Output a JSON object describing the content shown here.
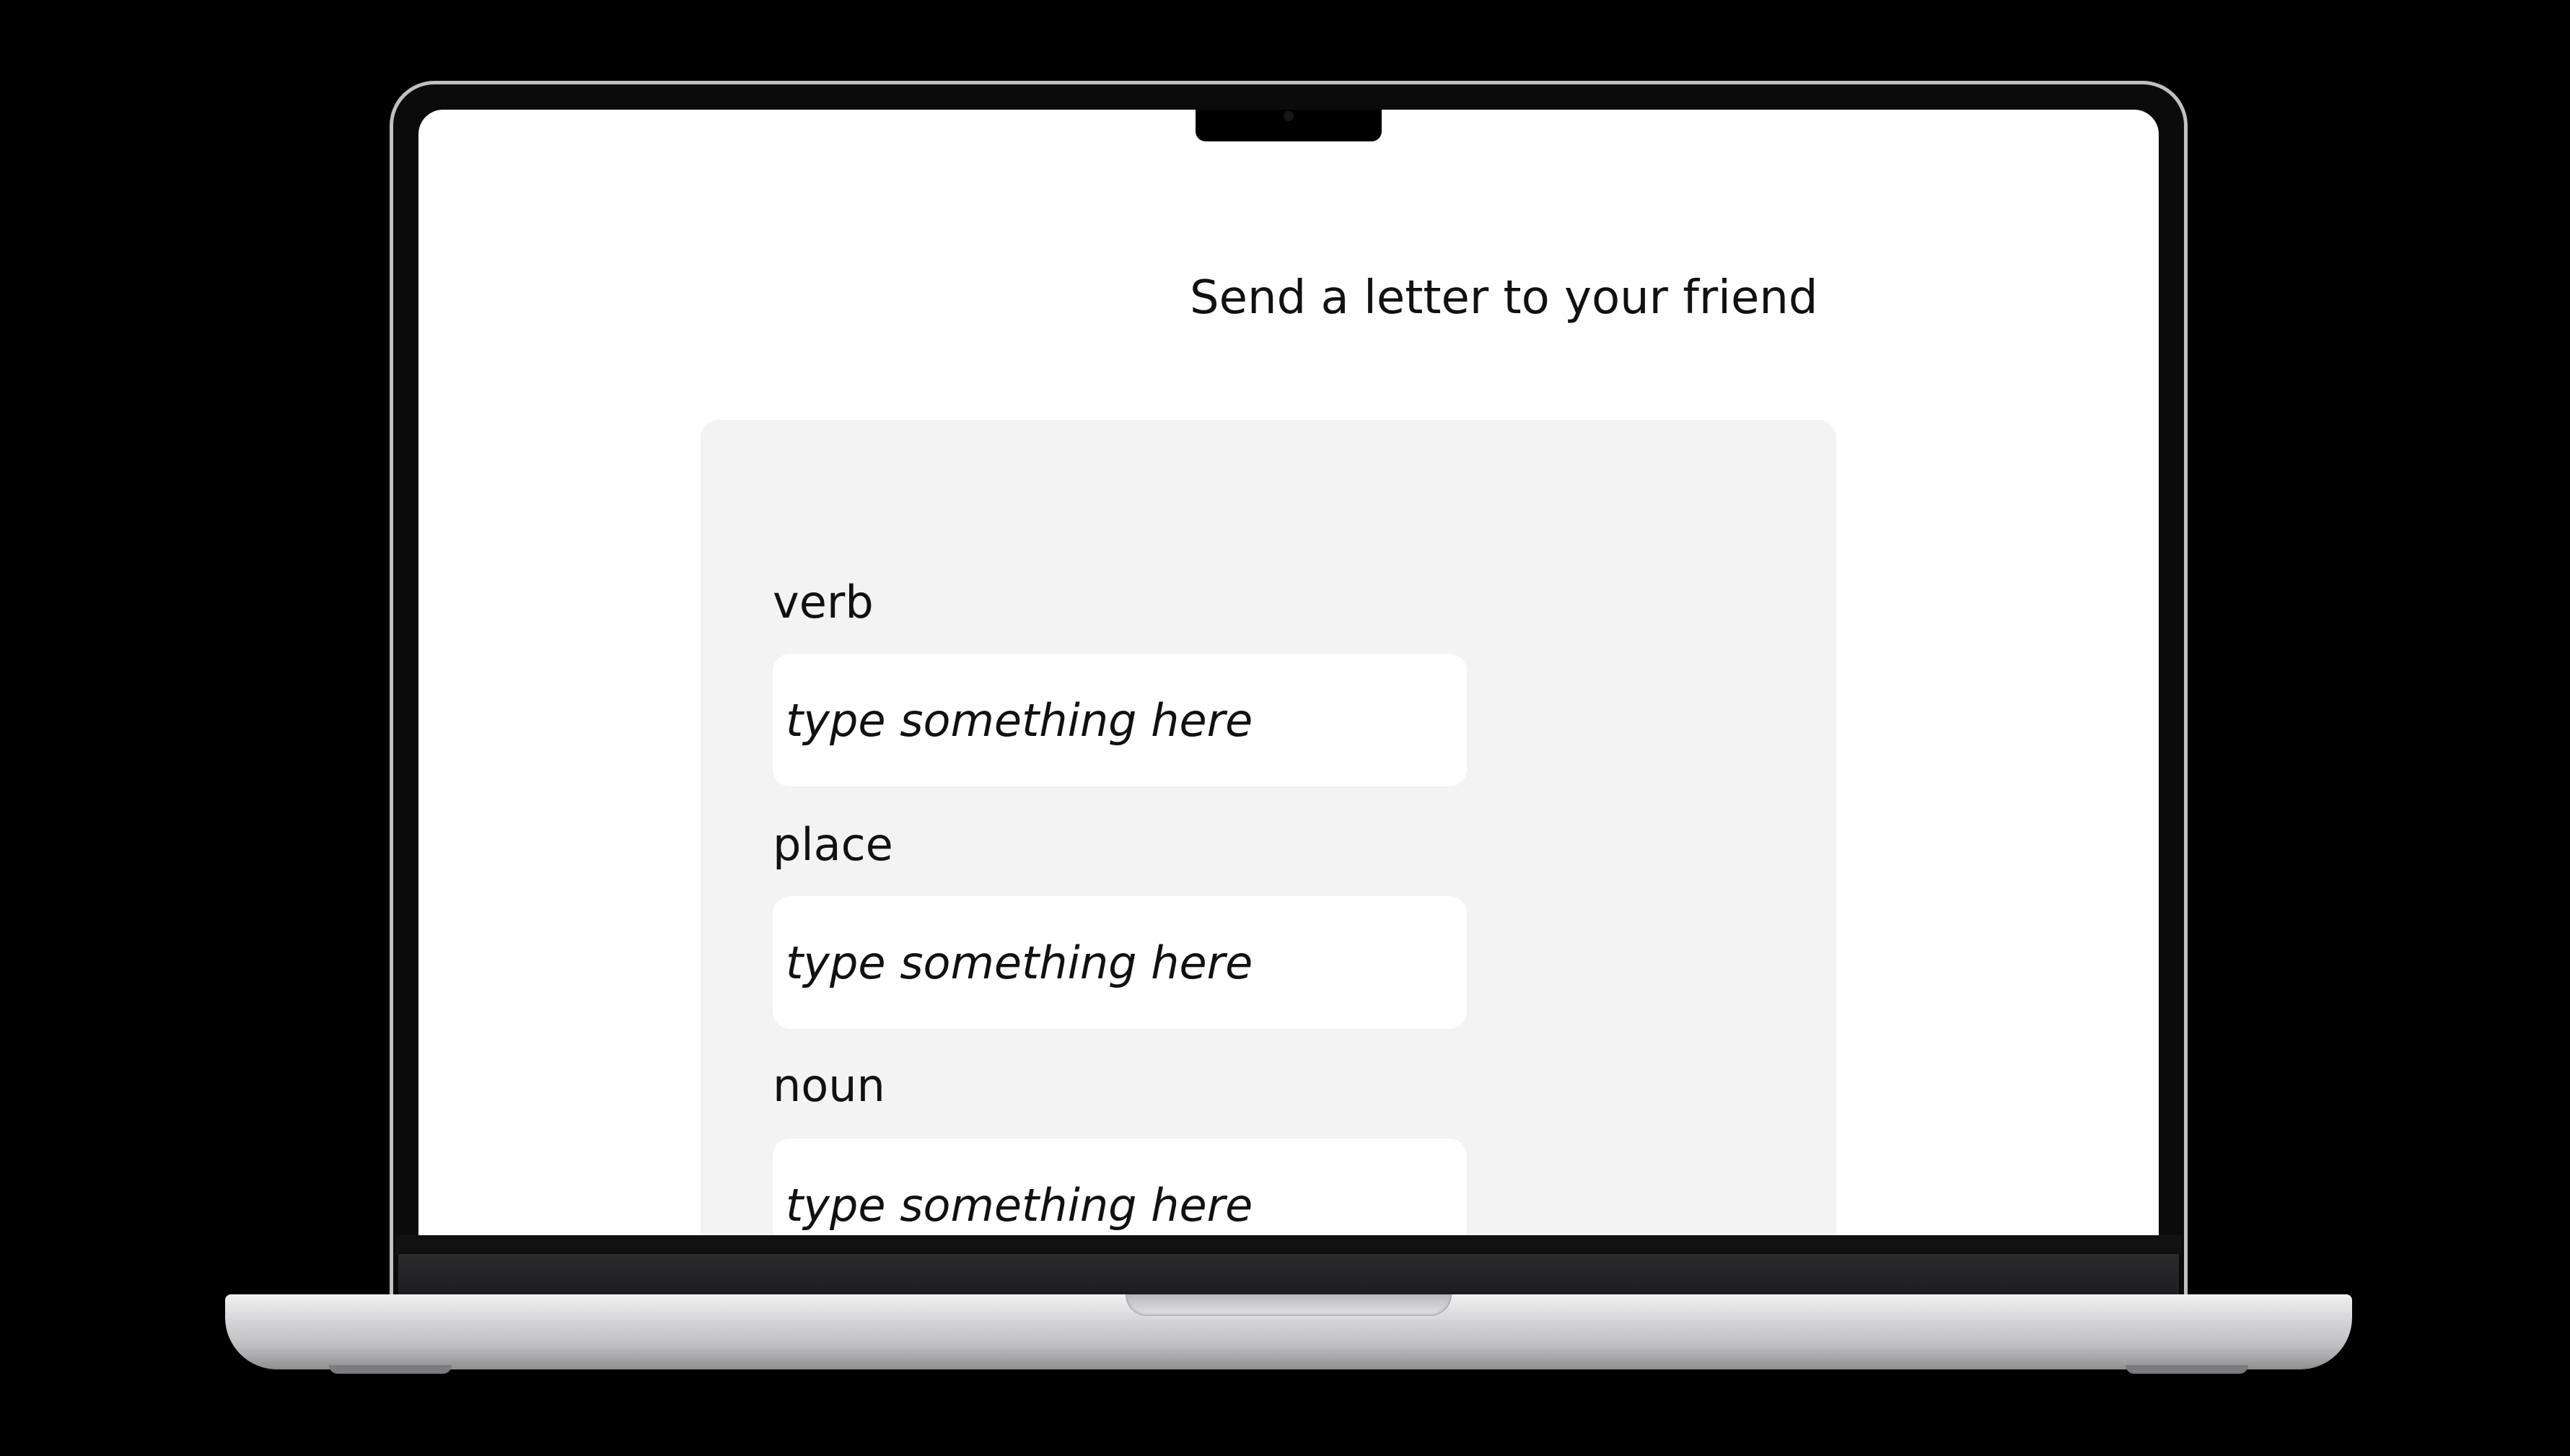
{
  "page": {
    "title": "Send a letter to your friend"
  },
  "form": {
    "fields": [
      {
        "label": "verb",
        "placeholder": "type something here",
        "value": ""
      },
      {
        "label": "place",
        "placeholder": "type something here",
        "value": ""
      },
      {
        "label": "noun",
        "placeholder": "type something here",
        "value": ""
      }
    ]
  },
  "colors": {
    "background": "#000000",
    "screen": "#ffffff",
    "card": "#f3f3f3",
    "input": "#ffffff",
    "text": "#111111",
    "device_frame": "#bfc0c2"
  },
  "device": {
    "type": "laptop-mockup",
    "icons": [
      "webcam-icon"
    ]
  }
}
